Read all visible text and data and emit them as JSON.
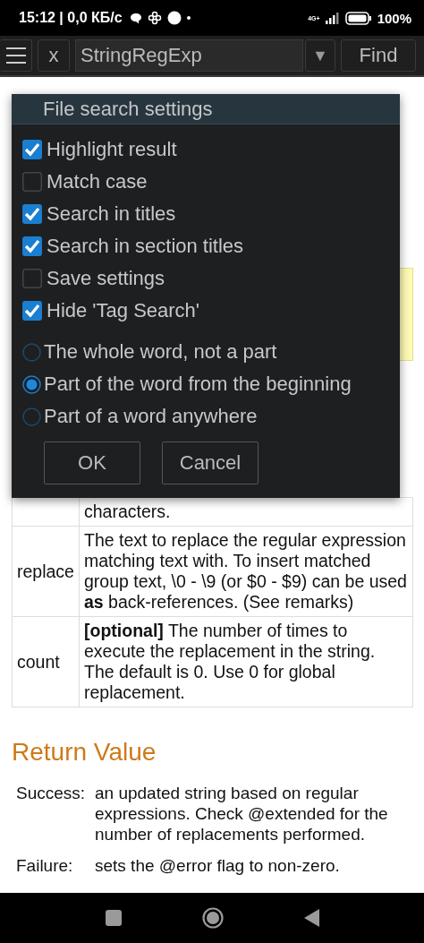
{
  "status_bar": {
    "time": "15:12 | 0,0 КБ/с",
    "network": "4G+",
    "battery": "100%"
  },
  "toolbar": {
    "close": "x",
    "search_value": "StringRegExp",
    "dropdown": "▼",
    "find": "Find"
  },
  "dialog": {
    "title": "File search settings",
    "options": [
      {
        "label": "Highlight result",
        "checked": true
      },
      {
        "label": "Match case",
        "checked": false
      },
      {
        "label": "Search in titles",
        "checked": true
      },
      {
        "label": "Search in section titles",
        "checked": true
      },
      {
        "label": "Save settings",
        "checked": false
      },
      {
        "label": "Hide 'Tag Search'",
        "checked": true
      }
    ],
    "match_modes": [
      {
        "label": "The whole word, not a part",
        "selected": false
      },
      {
        "label": "Part of the word from the beginning",
        "selected": true
      },
      {
        "label": "Part of a word anywhere",
        "selected": false
      }
    ],
    "buttons": [
      "OK",
      "Cancel"
    ]
  },
  "parameters": [
    {
      "description": "characters."
    },
    {
      "name": "replace",
      "description": "The text to replace the regular expression matching text with. To insert matched group text, \\0 - \\9 (or $0 - $9) can be used **as** back-references. (See remarks)"
    },
    {
      "name": "count",
      "description": "**[optional]** The number of times to execute the replacement in the string. The default is 0. Use 0 for global replacement."
    }
  ],
  "return_value": {
    "heading": "Return Value",
    "rows": [
      {
        "label": "Success:",
        "text": "an updated string based on regular expressions. Check @extended for the number of replacements performed."
      },
      {
        "label": "Failure:",
        "text": "sets the @error flag to non-zero."
      }
    ]
  }
}
